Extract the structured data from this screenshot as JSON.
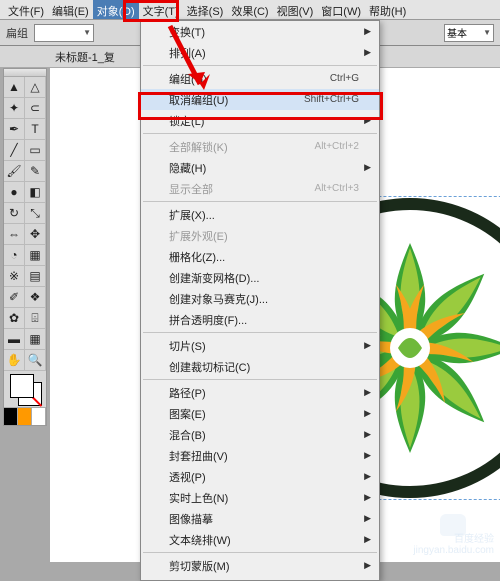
{
  "menubar": {
    "items": [
      {
        "label": "文件(F)"
      },
      {
        "label": "编辑(E)"
      },
      {
        "label": "对象(O)",
        "active": true
      },
      {
        "label": "文字(T)"
      },
      {
        "label": "选择(S)"
      },
      {
        "label": "效果(C)"
      },
      {
        "label": "视图(V)"
      },
      {
        "label": "窗口(W)"
      },
      {
        "label": "帮助(H)"
      }
    ]
  },
  "toolbar": {
    "label": "扁组",
    "select_value": "",
    "basic_label": "基本"
  },
  "doc_tab": "未标题-1_复",
  "menu": {
    "items": [
      {
        "label": "变换(T)",
        "sub": true
      },
      {
        "label": "排列(A)",
        "sub": true
      },
      {
        "sep": true
      },
      {
        "label": "编组(G)",
        "shortcut": "Ctrl+G"
      },
      {
        "label": "取消编组(U)",
        "shortcut": "Shift+Ctrl+G",
        "highlight": true
      },
      {
        "label": "锁定(L)",
        "sub": true
      },
      {
        "sep": true
      },
      {
        "label": "全部解锁(K)",
        "shortcut": "Alt+Ctrl+2",
        "disabled": true
      },
      {
        "label": "隐藏(H)",
        "sub": true
      },
      {
        "label": "显示全部",
        "shortcut": "Alt+Ctrl+3",
        "disabled": true
      },
      {
        "sep": true
      },
      {
        "label": "扩展(X)..."
      },
      {
        "label": "扩展外观(E)",
        "disabled": true
      },
      {
        "label": "栅格化(Z)..."
      },
      {
        "label": "创建渐变网格(D)..."
      },
      {
        "label": "创建对象马赛克(J)..."
      },
      {
        "label": "拼合透明度(F)..."
      },
      {
        "sep": true
      },
      {
        "label": "切片(S)",
        "sub": true
      },
      {
        "label": "创建裁切标记(C)"
      },
      {
        "sep": true
      },
      {
        "label": "路径(P)",
        "sub": true
      },
      {
        "label": "图案(E)",
        "sub": true
      },
      {
        "label": "混合(B)",
        "sub": true
      },
      {
        "label": "封套扭曲(V)",
        "sub": true
      },
      {
        "label": "透视(P)",
        "sub": true
      },
      {
        "label": "实时上色(N)",
        "sub": true
      },
      {
        "label": "图像描摹",
        "sub": true
      },
      {
        "label": "文本绕排(W)",
        "sub": true
      },
      {
        "sep": true
      },
      {
        "label": "剪切蒙版(M)",
        "sub": true,
        "cut": true
      }
    ]
  },
  "tools": {
    "names": [
      "selection",
      "direct-selection",
      "magic-wand",
      "lasso",
      "pen",
      "type",
      "line",
      "rectangle",
      "paintbrush",
      "pencil",
      "blob-brush",
      "eraser",
      "rotate",
      "scale",
      "width",
      "free-transform",
      "shape-builder",
      "perspective-grid",
      "mesh",
      "gradient",
      "eyedropper",
      "blend",
      "symbol-sprayer",
      "graph",
      "artboard",
      "slice",
      "hand",
      "zoom"
    ]
  },
  "swatches": {
    "colors": [
      "#000000",
      "#ff9900",
      "#ffffff"
    ]
  },
  "watermark": {
    "line1": "百度经验",
    "line2": "jingyan.baidu.com"
  }
}
